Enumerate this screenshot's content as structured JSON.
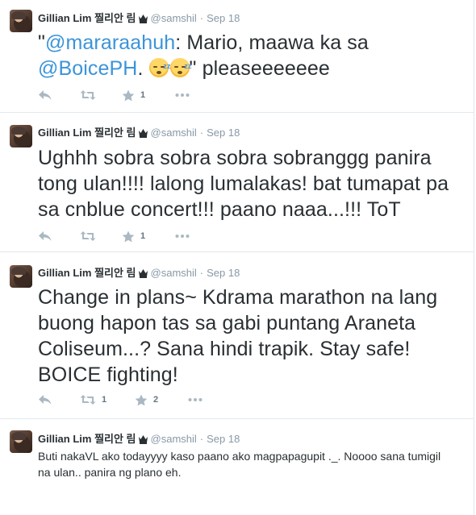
{
  "tweets": [
    {
      "name": "Gillian Lim 찔리안 림",
      "handle": "@samshil",
      "separator": "·",
      "date": "Sep 18",
      "text": {
        "quote_open": "\"",
        "mention1": "@mararaahuh",
        "part1": ": Mario, maawa ka sa ",
        "mention2": "@BoicePH",
        "part2": ". ",
        "emoji": "sleepy-face-emoji",
        "part3": "\" pleaseeeeeee"
      },
      "retweets": "",
      "favorites": "1"
    },
    {
      "name": "Gillian Lim 찔리안 림",
      "handle": "@samshil",
      "separator": "·",
      "date": "Sep 18",
      "text": "Ughhh sobra sobra sobra sobranggg panira tong ulan!!!! lalong lumalakas! bat tumapat pa sa cnblue concert!!! paano naaa...!!! ToT",
      "retweets": "",
      "favorites": "1"
    },
    {
      "name": "Gillian Lim 찔리안 림",
      "handle": "@samshil",
      "separator": "·",
      "date": "Sep 18",
      "text": "Change in plans~ Kdrama marathon na lang buong hapon tas sa gabi puntang Araneta Coliseum...? Sana hindi trapik. Stay safe! BOICE fighting!",
      "retweets": "1",
      "favorites": "2"
    },
    {
      "name": "Gillian Lim 찔리안 림",
      "handle": "@samshil",
      "separator": "·",
      "date": "Sep 18",
      "text": "Buti nakaVL ako todayyyy kaso paano ako magpapagupit ._. Noooo sana tumigil na ulan.. panira ng plano eh.",
      "retweets": "",
      "favorites": ""
    }
  ],
  "icons": {
    "reply": "reply-arrow-icon",
    "retweet": "retweet-icon",
    "favorite": "star-icon",
    "more": "more-dots-icon",
    "crown": "crown-icon"
  },
  "colors": {
    "link": "#3b94d9",
    "text": "#292f33",
    "meta": "#8899a6",
    "border": "#e1e8ed"
  }
}
